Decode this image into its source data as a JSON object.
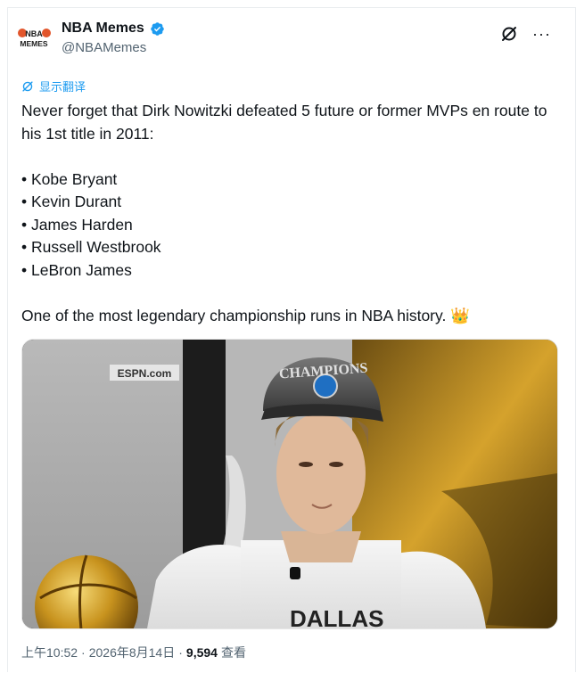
{
  "author": {
    "name": "NBA Memes",
    "handle": "@NBAMemes",
    "avatar_text_top": "NBA",
    "avatar_text_bottom": "MEMES"
  },
  "icons": {
    "verified": "verified-badge-icon",
    "grok": "grok-icon",
    "more": "more-icon",
    "translate": "translate-icon",
    "crown_emoji": "👑"
  },
  "translate_label": "显示翻译",
  "tweet": {
    "text": "Never forget that Dirk Nowitzki defeated 5 future or former MVPs en route to his 1st title in 2011:\n\n• Kobe Bryant\n• Kevin Durant\n• James Harden\n• Russell Westbrook\n• LeBron James\n\nOne of the most legendary championship runs in NBA history. 👑"
  },
  "media": {
    "watermark": "ESPN.com",
    "cap_text": "CHAMPIONS",
    "shirt_text": "DALLAS"
  },
  "meta": {
    "time": "上午10:52",
    "date": "2026年8月14日",
    "views_count": "9,594",
    "views_label": "查看"
  },
  "colors": {
    "accent": "#1d9bf0",
    "text": "#0f1419",
    "secondary": "#536471"
  }
}
